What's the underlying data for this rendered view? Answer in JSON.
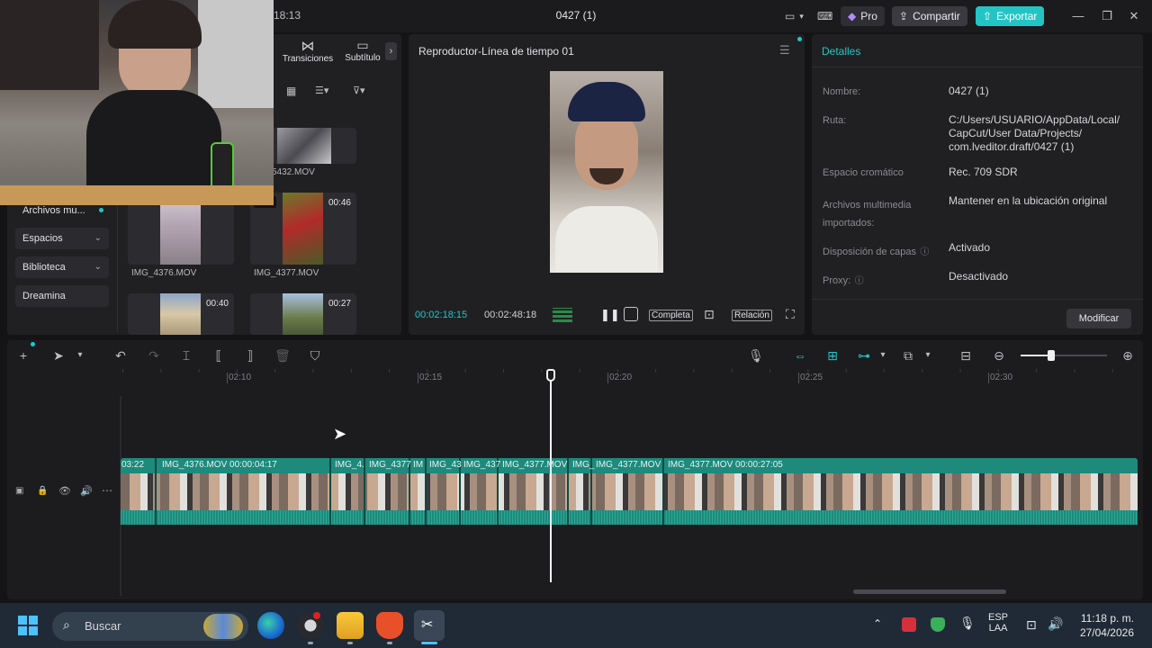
{
  "app": {
    "title": "0427 (1)",
    "time_fragment": "18:13",
    "pro_label": "Pro",
    "share_label": "Compartir",
    "export_label": "Exportar"
  },
  "media_tabs": {
    "transitions": "Transiciones",
    "subtitles": "Subtítulo"
  },
  "sidebar": {
    "items": [
      {
        "label": "Archivos mu..."
      },
      {
        "label": "Espacios"
      },
      {
        "label": "Biblioteca"
      },
      {
        "label": "Dreamina"
      }
    ]
  },
  "media": {
    "items": [
      {
        "name": "5432.MOV",
        "duration": ""
      },
      {
        "name": "IMG_4376.MOV",
        "duration": ""
      },
      {
        "name": "IMG_4377.MOV",
        "duration": "00:46",
        "badge": "dido"
      },
      {
        "name": "",
        "duration": "00:40"
      },
      {
        "name": "",
        "duration": "00:27"
      }
    ]
  },
  "player": {
    "title": "Reproductor-Línea de tiempo 01",
    "current_time": "00:02:18:15",
    "total_time": "00:02:48:18",
    "full_label": "Completa",
    "ratio_label": "Relación"
  },
  "details": {
    "title": "Detalles",
    "rows": [
      {
        "label": "Nombre:",
        "value": "0427 (1)"
      },
      {
        "label": "Ruta:",
        "value": "C:/Users/USUARIO/AppData/Local/ CapCut/User Data/Projects/ com.lveditor.draft/0427 (1)"
      },
      {
        "label": "Espacio cromático",
        "value": "Rec. 709 SDR"
      },
      {
        "label": "Archivos multimedia importados:",
        "value": "Mantener en la ubicación original"
      },
      {
        "label": "Disposición de capas",
        "value": "Activado"
      },
      {
        "label": "Proxy:",
        "value": "Desactivado"
      }
    ],
    "modify_label": "Modificar"
  },
  "timeline": {
    "ruler": [
      "02:10",
      "02:15",
      "02:20",
      "02:25",
      "02:30"
    ],
    "clips": [
      {
        "label": "03:22"
      },
      {
        "label": "IMG_4376.MOV   00:00:04:17"
      },
      {
        "label": "IMG_4."
      },
      {
        "label": "IMG_4377"
      },
      {
        "label": "IM"
      },
      {
        "label": "IMG_43"
      },
      {
        "label": "IMG_437"
      },
      {
        "label": "IMG_4377.MOV"
      },
      {
        "label": "IMG_"
      },
      {
        "label": "IMG_4377.MOV"
      },
      {
        "label": "IMG_4377.MOV   00:00:27:05"
      }
    ]
  },
  "taskbar": {
    "search_placeholder": "Buscar",
    "lang_top": "ESP",
    "lang_bottom": "LAA",
    "time": "11:18 p. m.",
    "date": "27/04/2026"
  },
  "colors": {
    "accent": "#1ec8c8",
    "clip": "#1d8a7c",
    "export": "#25c4c4"
  }
}
